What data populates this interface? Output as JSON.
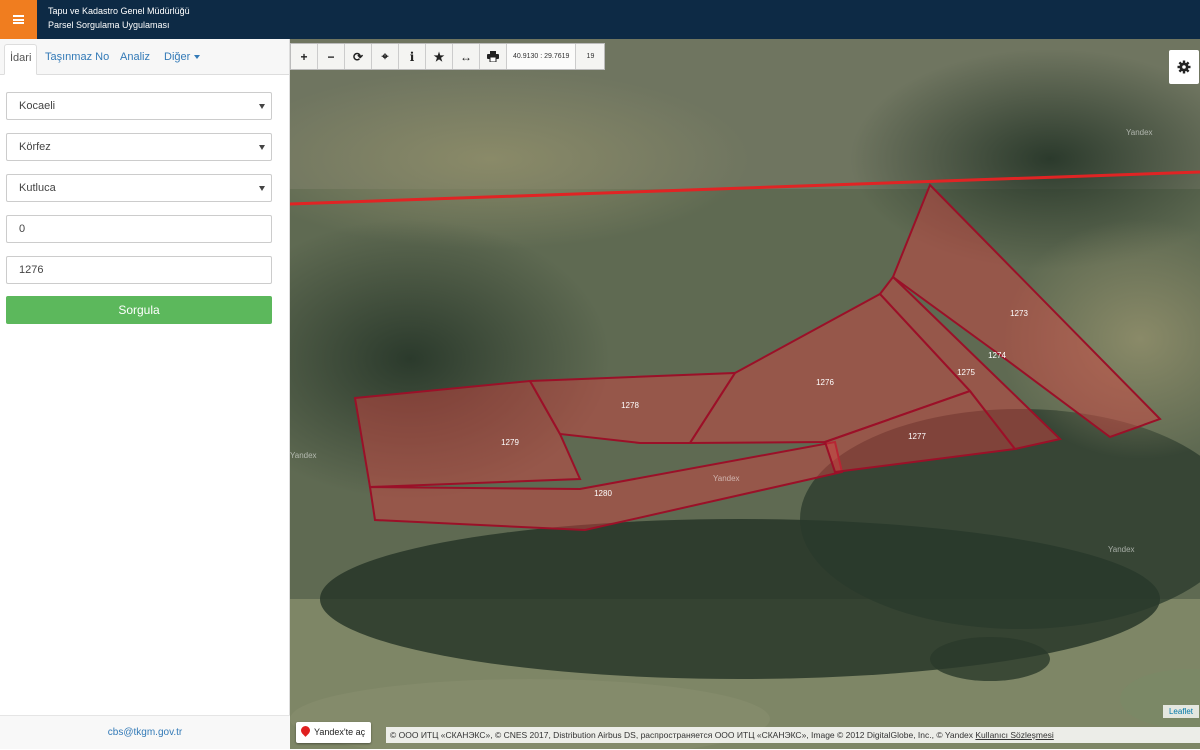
{
  "header": {
    "title_line1": "Tapu ve Kadastro Genel Müdürlüğü",
    "title_line2": "Parsel Sorgulama Uygulaması",
    "menu_icon": "hamburger-icon"
  },
  "sidebar": {
    "tabs": [
      "İdari",
      "Taşınmaz No",
      "Analiz",
      "Diğer"
    ],
    "fields": {
      "province": "Kocaeli",
      "district": "Körfez",
      "neighborhood": "Kutluca",
      "block_no": "0",
      "parcel_no": "1276"
    },
    "query_button": "Sorgula",
    "footer_email": "cbs@tkgm.gov.tr"
  },
  "map": {
    "coords": "40.9130 : 29.7619",
    "zoom": "19",
    "parcels": [
      "1273",
      "1274",
      "1275",
      "1276",
      "1277",
      "1278",
      "1279",
      "1280"
    ],
    "watermarks": [
      "Yandex",
      "Yandex",
      "Yandex",
      "Yandex"
    ],
    "yandex_open": "Yandex'te aç",
    "attribution_text": "© ООО ИТЦ «СКАНЭКС», © CNES 2017, Distribution Airbus DS, распространяется ООО ИТЦ «СКАНЭКС», Image © 2012 DigitalGlobe, Inc., © Yandex ",
    "attribution_link": "Kullanıcı Sözleşmesi",
    "leaflet": "Leaflet",
    "parcel_fill": "#d94040",
    "parcel_stroke": "#9b1028",
    "boundary_color": "#e02424"
  }
}
